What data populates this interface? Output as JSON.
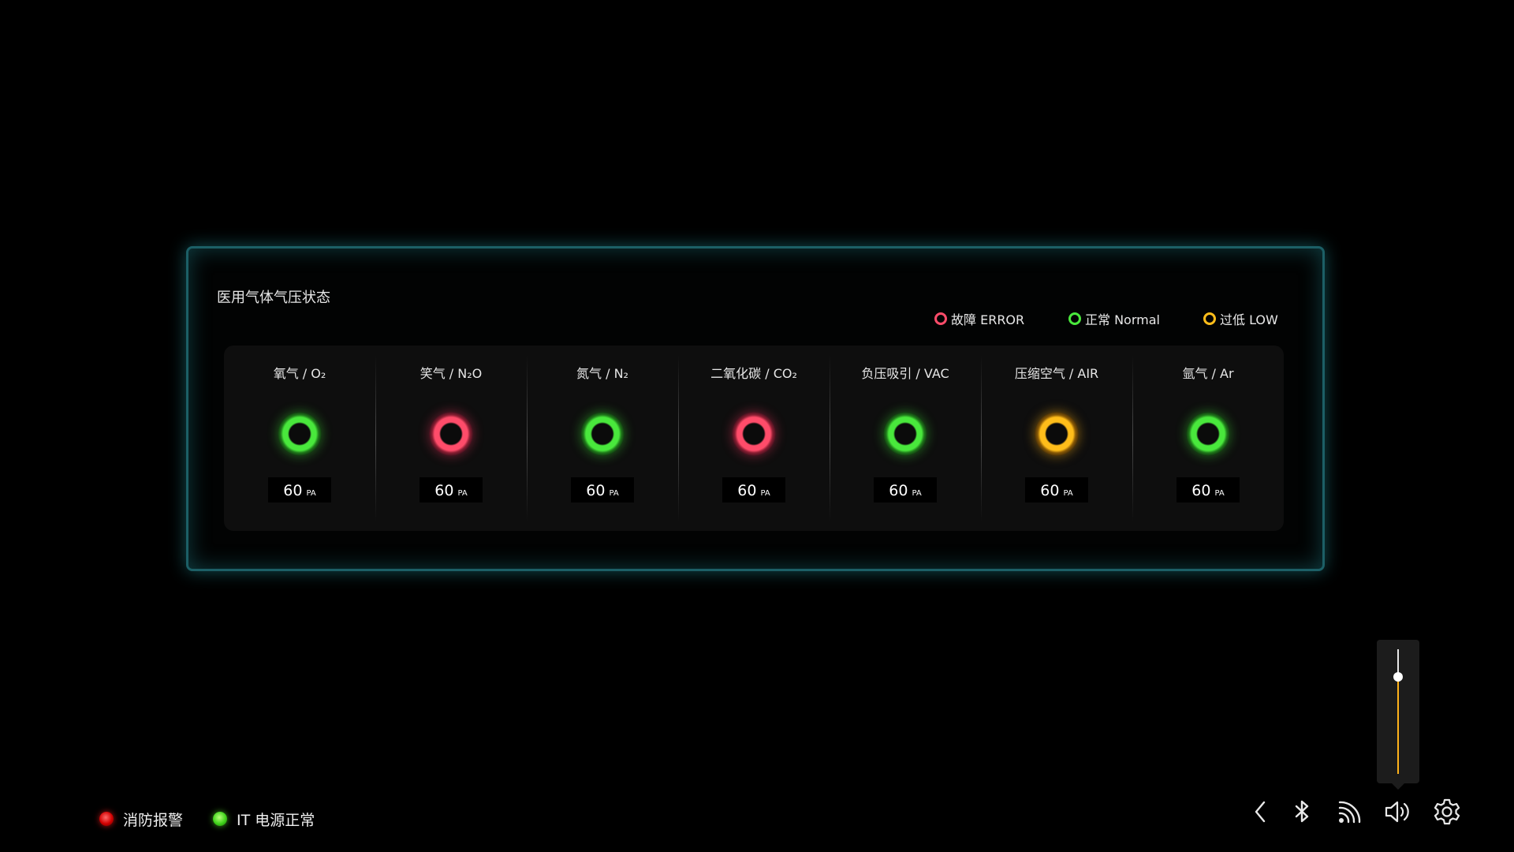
{
  "panel": {
    "title": "医用气体气压状态",
    "legend": [
      {
        "label": "故障 ERROR",
        "status": "error"
      },
      {
        "label": "正常 Normal",
        "status": "normal"
      },
      {
        "label": "过低 LOW",
        "status": "low"
      }
    ]
  },
  "gases": [
    {
      "name": "氧气 / O₂",
      "status": "normal",
      "value": "60",
      "unit": "PA"
    },
    {
      "name": "笑气 / N₂O",
      "status": "error",
      "value": "60",
      "unit": "PA"
    },
    {
      "name": "氮气 / N₂",
      "status": "normal",
      "value": "60",
      "unit": "PA"
    },
    {
      "name": "二氧化碳 / CO₂",
      "status": "error",
      "value": "60",
      "unit": "PA"
    },
    {
      "name": "负压吸引 / VAC",
      "status": "normal",
      "value": "60",
      "unit": "PA"
    },
    {
      "name": "压缩空气 / AIR",
      "status": "low",
      "value": "60",
      "unit": "PA"
    },
    {
      "name": "氩气 / Ar",
      "status": "normal",
      "value": "60",
      "unit": "PA"
    }
  ],
  "status_bar": {
    "fire_alarm": "消防报警",
    "it_power": "IT 电源正常"
  },
  "volume": {
    "level": 0.78
  },
  "icons": {
    "back": "chevron-left-icon",
    "bluetooth": "bluetooth-icon",
    "wireless": "wireless-signal-icon",
    "volume": "volume-icon",
    "settings": "gear-icon"
  },
  "colors": {
    "normal": "#49e83c",
    "error": "#ff4c6a",
    "low": "#ffbd1a",
    "panel_border": "#1c5f66",
    "slider_fill": "#ffb21a"
  }
}
